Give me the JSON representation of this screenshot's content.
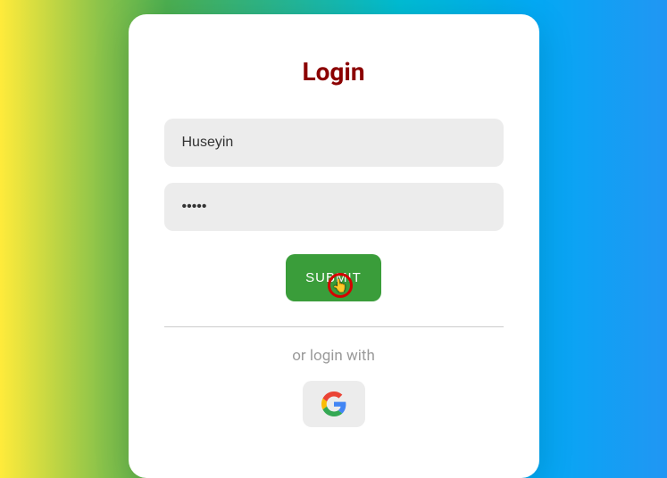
{
  "title": "Login",
  "form": {
    "username_value": "Huseyin",
    "password_value": "•••••",
    "submit_label": "SUBMIT"
  },
  "alt_login": {
    "text": "or login with",
    "provider": "Google"
  },
  "colors": {
    "title": "#8b0000",
    "submit_bg": "#3a9d3a",
    "input_bg": "#ececec"
  }
}
